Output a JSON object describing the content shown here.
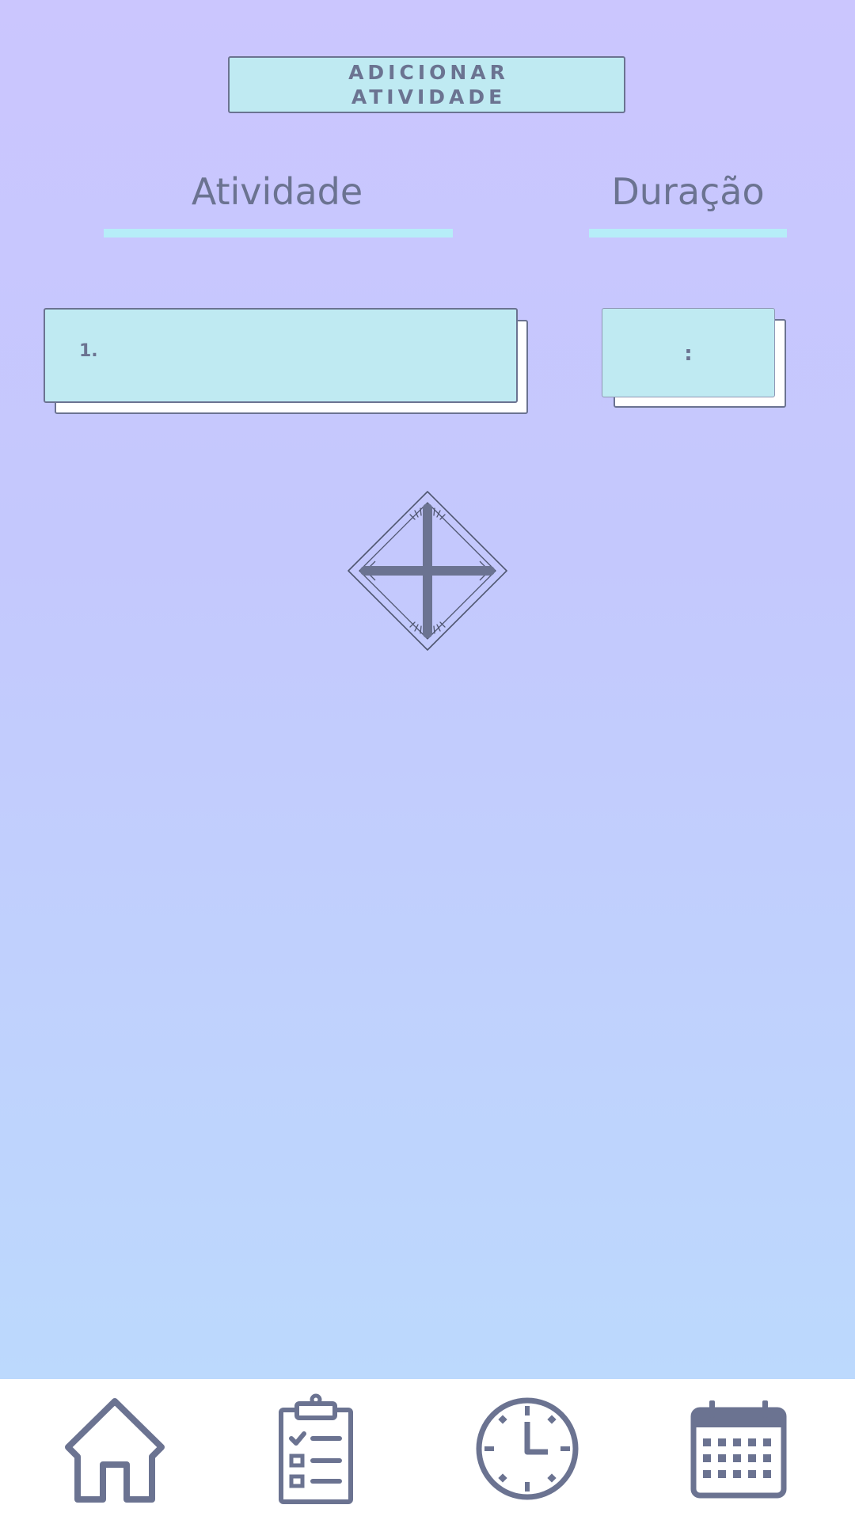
{
  "header": {
    "button_line1": "ADICIONAR",
    "button_line2": "ATIVIDADE"
  },
  "columns": {
    "activity_heading": "Atividade",
    "duration_heading": "Duração"
  },
  "rows": [
    {
      "number": "1.",
      "activity": "",
      "duration_separator": ":"
    }
  ],
  "add_button": {
    "icon": "plus-icon"
  },
  "bottom_nav": {
    "items": [
      {
        "icon": "home-icon"
      },
      {
        "icon": "clipboard-checklist-icon"
      },
      {
        "icon": "clock-icon"
      },
      {
        "icon": "calendar-icon"
      }
    ]
  },
  "colors": {
    "background_top": "#cbc6fe",
    "background_bottom": "#bcd9fd",
    "field_fill": "#bfeaf2",
    "accent_line": "#b6edf8",
    "ink": "#6b7391",
    "nav_background": "#ffffff"
  }
}
